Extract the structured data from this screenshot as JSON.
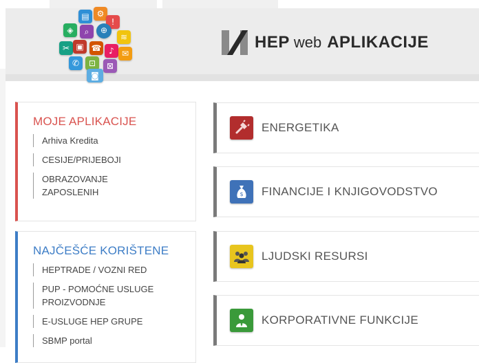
{
  "header": {
    "brand_hep": "HEP",
    "brand_web": "web",
    "brand_apps": "APLIKACIJE"
  },
  "moje_aplikacije": {
    "title": "MOJE APLIKACIJE",
    "items": [
      {
        "label": "Arhiva Kredita"
      },
      {
        "label": "CESIJE/PRIJEBOJI"
      },
      {
        "label": "OBRAZOVANJE ZAPOSLENIH"
      }
    ]
  },
  "najcesce": {
    "title": "NAJČEŠĆE KORIŠTENE",
    "items": [
      {
        "label": "HEPTRADE / VOZNI RED"
      },
      {
        "label": "PUP - POMOĆNE USLUGE PROIZVODNJE"
      },
      {
        "label": "E-USLUGE HEP GRUPE"
      },
      {
        "label": "SBMP portal"
      }
    ]
  },
  "categories": [
    {
      "label": "ENERGETIKA",
      "icon": "plug-icon",
      "color": "#b22d2d"
    },
    {
      "label": "FINANCIJE I KNJIGOVODSTVO",
      "icon": "money-bag-icon",
      "color": "#3f72b8"
    },
    {
      "label": "LJUDSKI RESURSI",
      "icon": "people-group-icon",
      "color": "#e8c51e"
    },
    {
      "label": "KORPORATIVNE FUNKCIJE",
      "icon": "businessman-icon",
      "color": "#3a9a3a"
    }
  ],
  "colors": {
    "red_accent": "#d9534f",
    "blue_accent": "#3d7dc6",
    "category_border": "#7a7a7a"
  }
}
